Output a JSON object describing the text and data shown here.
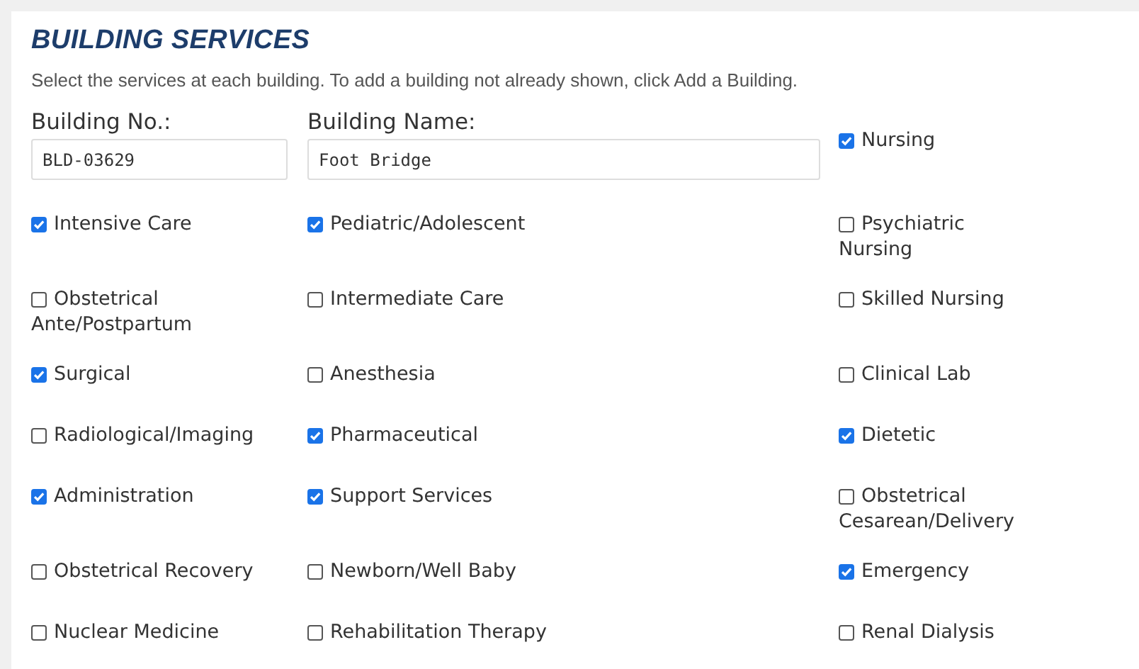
{
  "title": "BUILDING SERVICES",
  "description": "Select the services at each building. To add a building not already shown, click Add a Building.",
  "fields": [
    {
      "label": "Building No.:",
      "value": "BLD-03629"
    },
    {
      "label": "Building Name:",
      "value": "Foot Bridge"
    }
  ],
  "nursing": {
    "label": "Nursing",
    "checked": true
  },
  "services": [
    [
      {
        "label": "Intensive Care",
        "checked": true
      },
      {
        "label": "Pediatric/Adolescent",
        "checked": true
      },
      {
        "label": "Psychiatric Nursing",
        "checked": false
      }
    ],
    [
      {
        "label": "Obstetrical Ante/Postpartum",
        "checked": false
      },
      {
        "label": "Intermediate Care",
        "checked": false
      },
      {
        "label": "Skilled Nursing",
        "checked": false
      }
    ],
    [
      {
        "label": "Surgical",
        "checked": true
      },
      {
        "label": "Anesthesia",
        "checked": false
      },
      {
        "label": "Clinical Lab",
        "checked": false
      }
    ],
    [
      {
        "label": "Radiological/Imaging",
        "checked": false
      },
      {
        "label": "Pharmaceutical",
        "checked": true
      },
      {
        "label": "Dietetic",
        "checked": true
      }
    ],
    [
      {
        "label": "Administration",
        "checked": true
      },
      {
        "label": "Support Services",
        "checked": true
      },
      {
        "label": "Obstetrical Cesarean/Delivery",
        "checked": false
      }
    ],
    [
      {
        "label": "Obstetrical Recovery",
        "checked": false
      },
      {
        "label": "Newborn/Well Baby",
        "checked": false
      },
      {
        "label": "Emergency",
        "checked": true
      }
    ],
    [
      {
        "label": "Nuclear Medicine",
        "checked": false
      },
      {
        "label": "Rehabilitation Therapy",
        "checked": false
      },
      {
        "label": "Renal Dialysis",
        "checked": false
      }
    ]
  ]
}
